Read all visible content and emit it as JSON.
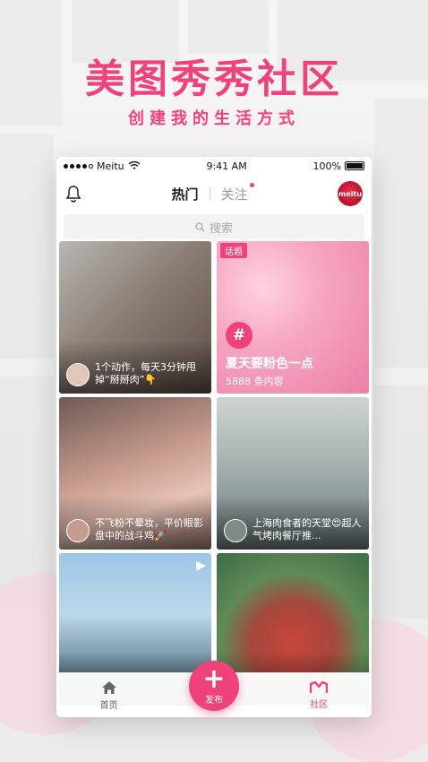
{
  "promo": {
    "title": "美图秀秀社区",
    "subtitle": "创建我的生活方式"
  },
  "status_bar": {
    "carrier": "Meitu",
    "time": "9:41 AM",
    "battery": "100%"
  },
  "nav": {
    "tab_hot": "热门",
    "tab_follow": "关注"
  },
  "search": {
    "placeholder": "搜索"
  },
  "cards": [
    {
      "caption": "1个动作，每天3分钟甩掉“掰掰肉”👇"
    },
    {
      "tag": "话题",
      "title": "夏天要粉色一点",
      "count": "5888 条内容"
    },
    {
      "caption": "不飞粉不晕妆，平价眼影盘中的战斗鸡🚀"
    },
    {
      "caption": "上海肉食者的天堂😍超人气烤肉餐厅推..."
    },
    {
      "caption": ""
    },
    {
      "caption": ""
    }
  ],
  "bottom_bar": {
    "home_label": "首页",
    "publish_label": "发布",
    "community_label": "社区"
  },
  "colors": {
    "accent": "#f0427a"
  }
}
